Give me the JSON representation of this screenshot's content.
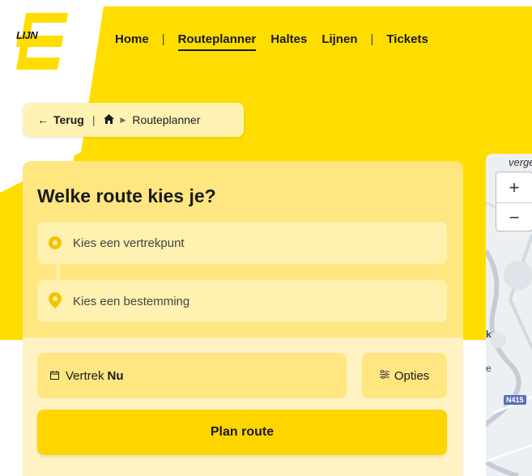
{
  "brand": {
    "logo_text": "LIJN",
    "accent": "#ffdd00",
    "accent_light": "#ffe680"
  },
  "nav": {
    "items": [
      {
        "label": "Home",
        "active": false
      },
      {
        "label": "Routeplanner",
        "active": true
      },
      {
        "label": "Haltes",
        "active": false
      },
      {
        "label": "Lijnen",
        "active": false
      },
      {
        "label": "Tickets",
        "active": false
      }
    ],
    "separator": "|"
  },
  "breadcrumb": {
    "back_arrow": "←",
    "back_label": "Terug",
    "home_icon": "home-icon",
    "current": "Routeplanner"
  },
  "planner": {
    "title": "Welke route kies je?",
    "origin_placeholder": "Kies een vertrekpunt",
    "destination_placeholder": "Kies een bestemming",
    "departure_label": "Vertrek",
    "departure_value": "Nu",
    "options_label": "Opties",
    "plan_button": "Plan route"
  },
  "map": {
    "zoom_in": "+",
    "zoom_out": "−",
    "place_label": "vergem",
    "road_badge": "N415",
    "fragment_k": "k",
    "fragment_e": "e"
  }
}
